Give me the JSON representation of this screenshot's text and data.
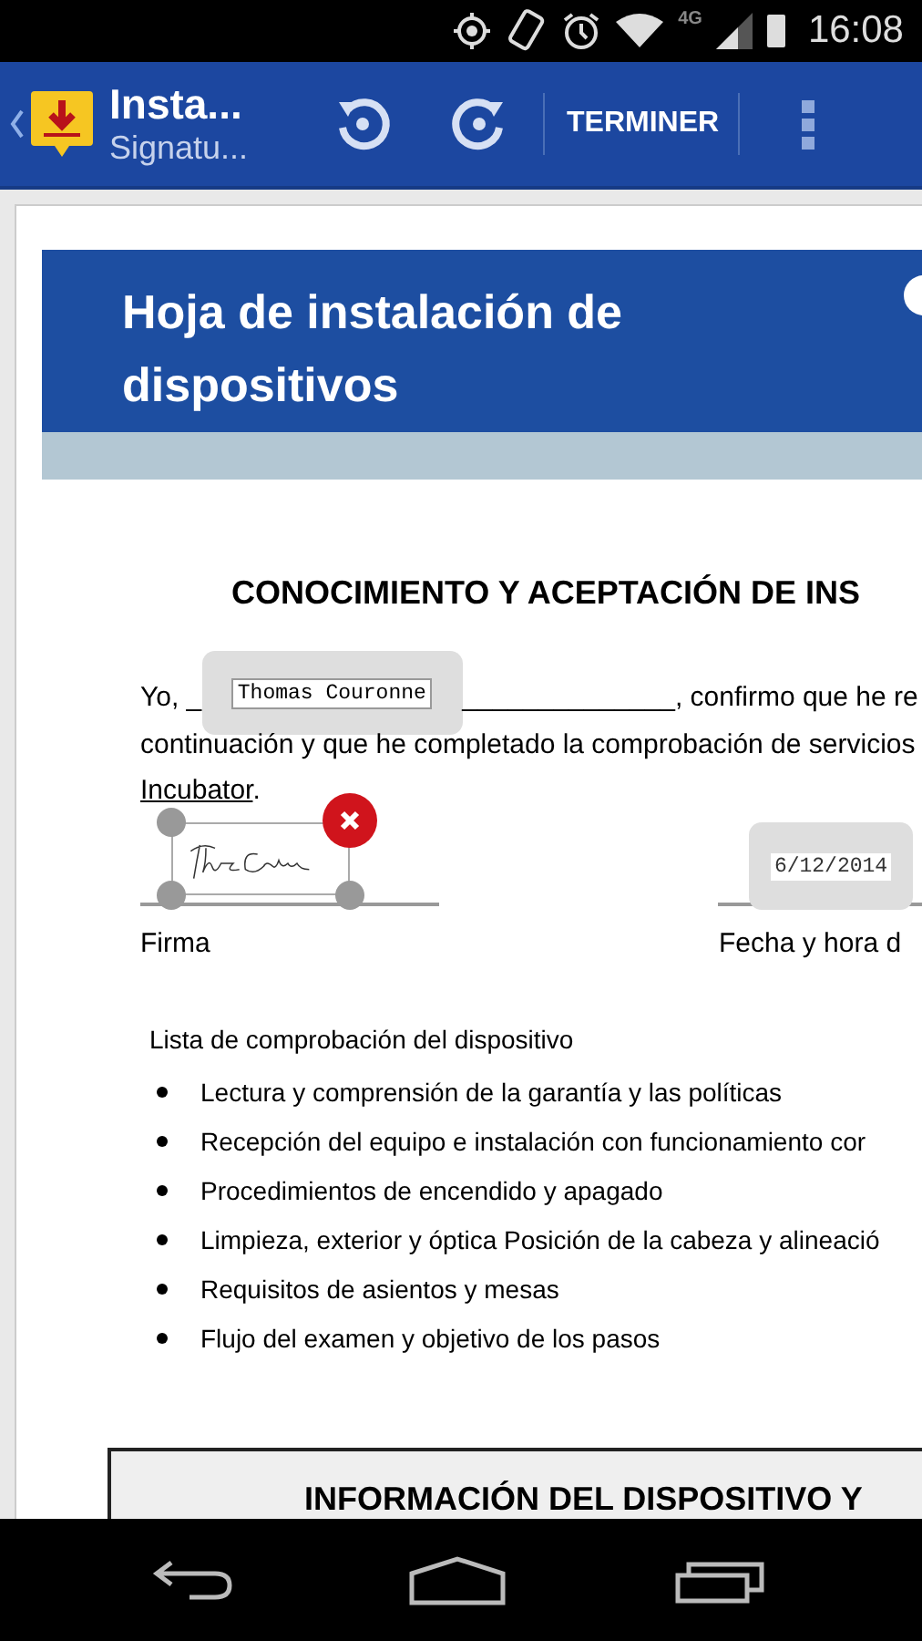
{
  "status_bar": {
    "network": "4G",
    "time": "16:08"
  },
  "app_bar": {
    "title": "Insta...",
    "subtitle": "Signatu...",
    "action": "TERMINER"
  },
  "document": {
    "header_title": "Hoja de instalación de dispositivos",
    "heading": "CONOCIMIENTO Y ACEPTACIÓN DE INS",
    "name_line": {
      "before": "Yo, _",
      "after": "______________, confirmo que he re"
    },
    "paragraph_lines": [
      "continuación y que he completado la comprobación de servicios"
    ],
    "device_link": "Incubator",
    "device_link_end": ".",
    "name_field": {
      "value": "Thomas Couronne"
    },
    "signature_label": "Firma",
    "date_field": {
      "value": "6/12/2014"
    },
    "date_label": "Fecha y hora d",
    "checklist_title": "Lista de comprobación del dispositivo",
    "checklist": [
      "Lectura y comprensión de la garantía y las políticas",
      "Recepción del equipo e instalación con funcionamiento cor",
      "Procedimientos de encendido y apagado",
      "Limpieza, exterior y óptica Posición de la cabeza y alineació",
      "Requisitos de asientos y mesas",
      "Flujo del examen y objetivo de los pasos"
    ],
    "section_title": "INFORMACIÓN DEL DISPOSITIVO Y"
  }
}
